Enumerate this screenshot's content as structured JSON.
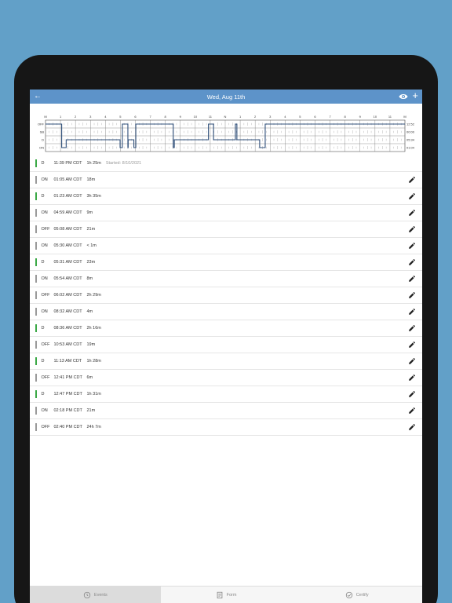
{
  "header": {
    "title": "Wed, Aug 11th"
  },
  "graph": {
    "hour_labels": [
      "M",
      "1",
      "2",
      "3",
      "4",
      "5",
      "6",
      "7",
      "8",
      "9",
      "10",
      "11",
      "N",
      "1",
      "2",
      "3",
      "4",
      "5",
      "6",
      "7",
      "8",
      "9",
      "10",
      "11",
      "M"
    ],
    "row_labels": [
      "OFF",
      "SB",
      "D",
      "ON"
    ],
    "totals": [
      "12:52",
      "00:00",
      "05:34",
      "01:04"
    ],
    "segments": [
      {
        "status": "OFF",
        "start": 0.0,
        "end": 1.08
      },
      {
        "status": "ON",
        "start": 1.08,
        "end": 1.38
      },
      {
        "status": "D",
        "start": 1.38,
        "end": 4.98
      },
      {
        "status": "ON",
        "start": 4.98,
        "end": 5.13
      },
      {
        "status": "OFF",
        "start": 5.13,
        "end": 5.5
      },
      {
        "status": "ON",
        "start": 5.5,
        "end": 5.52
      },
      {
        "status": "D",
        "start": 5.52,
        "end": 5.9
      },
      {
        "status": "ON",
        "start": 5.9,
        "end": 6.03
      },
      {
        "status": "OFF",
        "start": 6.03,
        "end": 8.53
      },
      {
        "status": "ON",
        "start": 8.53,
        "end": 8.6
      },
      {
        "status": "D",
        "start": 8.6,
        "end": 10.88
      },
      {
        "status": "OFF",
        "start": 10.88,
        "end": 11.22
      },
      {
        "status": "D",
        "start": 11.22,
        "end": 12.68
      },
      {
        "status": "OFF",
        "start": 12.68,
        "end": 12.78
      },
      {
        "status": "D",
        "start": 12.78,
        "end": 14.3
      },
      {
        "status": "ON",
        "start": 14.3,
        "end": 14.67
      },
      {
        "status": "OFF",
        "start": 14.67,
        "end": 24.0
      }
    ]
  },
  "events": [
    {
      "status": "D",
      "time": "11:39 PM CDT",
      "duration": "1h 25m",
      "note": "Started: 8/10/2021",
      "editable": false
    },
    {
      "status": "ON",
      "time": "01:05 AM CDT",
      "duration": "18m",
      "note": "",
      "editable": true
    },
    {
      "status": "D",
      "time": "01:23 AM CDT",
      "duration": "3h 35m",
      "note": "",
      "editable": true
    },
    {
      "status": "ON",
      "time": "04:59 AM CDT",
      "duration": "9m",
      "note": "",
      "editable": true
    },
    {
      "status": "OFF",
      "time": "05:08 AM CDT",
      "duration": "21m",
      "note": "",
      "editable": true
    },
    {
      "status": "ON",
      "time": "05:30 AM CDT",
      "duration": "< 1m",
      "note": "",
      "editable": true
    },
    {
      "status": "D",
      "time": "05:31 AM CDT",
      "duration": "23m",
      "note": "",
      "editable": true
    },
    {
      "status": "ON",
      "time": "05:54 AM CDT",
      "duration": "8m",
      "note": "",
      "editable": true
    },
    {
      "status": "OFF",
      "time": "06:02 AM CDT",
      "duration": "2h 29m",
      "note": "",
      "editable": true
    },
    {
      "status": "ON",
      "time": "08:32 AM CDT",
      "duration": "4m",
      "note": "",
      "editable": true
    },
    {
      "status": "D",
      "time": "08:36 AM CDT",
      "duration": "2h 16m",
      "note": "",
      "editable": true
    },
    {
      "status": "OFF",
      "time": "10:53 AM CDT",
      "duration": "19m",
      "note": "",
      "editable": true
    },
    {
      "status": "D",
      "time": "11:13 AM CDT",
      "duration": "1h 28m",
      "note": "",
      "editable": true
    },
    {
      "status": "OFF",
      "time": "12:41 PM CDT",
      "duration": "6m",
      "note": "",
      "editable": true
    },
    {
      "status": "D",
      "time": "12:47 PM CDT",
      "duration": "1h 31m",
      "note": "",
      "editable": true
    },
    {
      "status": "ON",
      "time": "02:18 PM CDT",
      "duration": "21m",
      "note": "",
      "editable": true
    },
    {
      "status": "OFF",
      "time": "02:40 PM CDT",
      "duration": "24h 7m",
      "note": "",
      "editable": true
    }
  ],
  "status_colors": {
    "D": "#3aa845",
    "ON": "#9a9a9a",
    "OFF": "#9a9a9a",
    "SB": "#9a9a9a"
  },
  "colors": {
    "header": "#5d93c9",
    "graph_line": "#2f4f7a",
    "background": "#62a0c8"
  },
  "tabs": [
    {
      "label": "Events",
      "icon": "clock-icon",
      "active": true
    },
    {
      "label": "Form",
      "icon": "document-icon",
      "active": false
    },
    {
      "label": "Certify",
      "icon": "check-circle-icon",
      "active": false
    }
  ]
}
